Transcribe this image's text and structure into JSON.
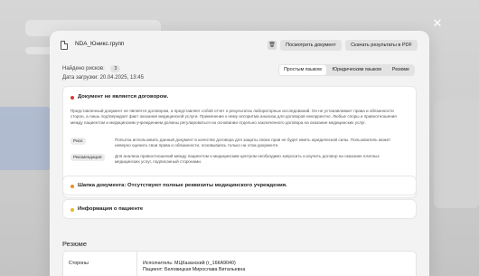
{
  "header": {
    "file_name": "NDA_Юникс.групп",
    "view_document_label": "Посмотреть документ",
    "download_pdf_label": "Скачать результаты в PDF"
  },
  "info": {
    "risks_label": "Найдено рисков:",
    "risks_count": "3",
    "upload_label": "Дата загрузки:",
    "upload_date": "20.04.2025, 13:45"
  },
  "tabs": [
    {
      "label": "Простым языком",
      "active": true
    },
    {
      "label": "Юридическим языком",
      "active": false
    },
    {
      "label": "Резюме",
      "active": false
    }
  ],
  "risks": [
    {
      "title": "Документ не является договором.",
      "color": "#d63a2f",
      "description": "Представленный документ не является договором, а представляет собой отчет о результатах лабораторных исследований. Он не устанавливает права и обязанности сторон, а лишь подтверждает факт оказания медицинской услуги. Применение к нему алгоритма анализа для договоров некорректно. Любые споры и правоотношения между пациентом и медицинским учреждением должны регулироваться на основании отдельно заключенного договора на оказание медицинских услуг.",
      "risk_label": "Риск:",
      "risk_text": "Попытка использовать данный документ в качестве договора для защиты своих прав не будет иметь юридической силы. Пользователь может неверно оценить свои права и обязанности, основываясь только на этом документе.",
      "rec_label": "Рекомендация:",
      "rec_text": "Для анализа правоотношений между пациентом и медицинским центром необходимо запросить и изучить договор на оказание платных медицинских услуг, подписанный сторонами."
    },
    {
      "title": "Шапка документа: Отсутствуют полные реквизиты медицинского учреждения.",
      "color": "#e8912a"
    },
    {
      "title": "Информация о пациенте",
      "color": "#e8b92a"
    }
  ],
  "summary": {
    "heading": "Резюме",
    "row_label": "Стороны",
    "row_value_1": "Исполнитель: МЦКазанский (г_16КА9040)",
    "row_value_2": "Пациент: Беловицкая Мирослава Витальевна"
  },
  "icons": {
    "file": "file-icon",
    "trash": "trash-icon",
    "close": "close-icon"
  }
}
